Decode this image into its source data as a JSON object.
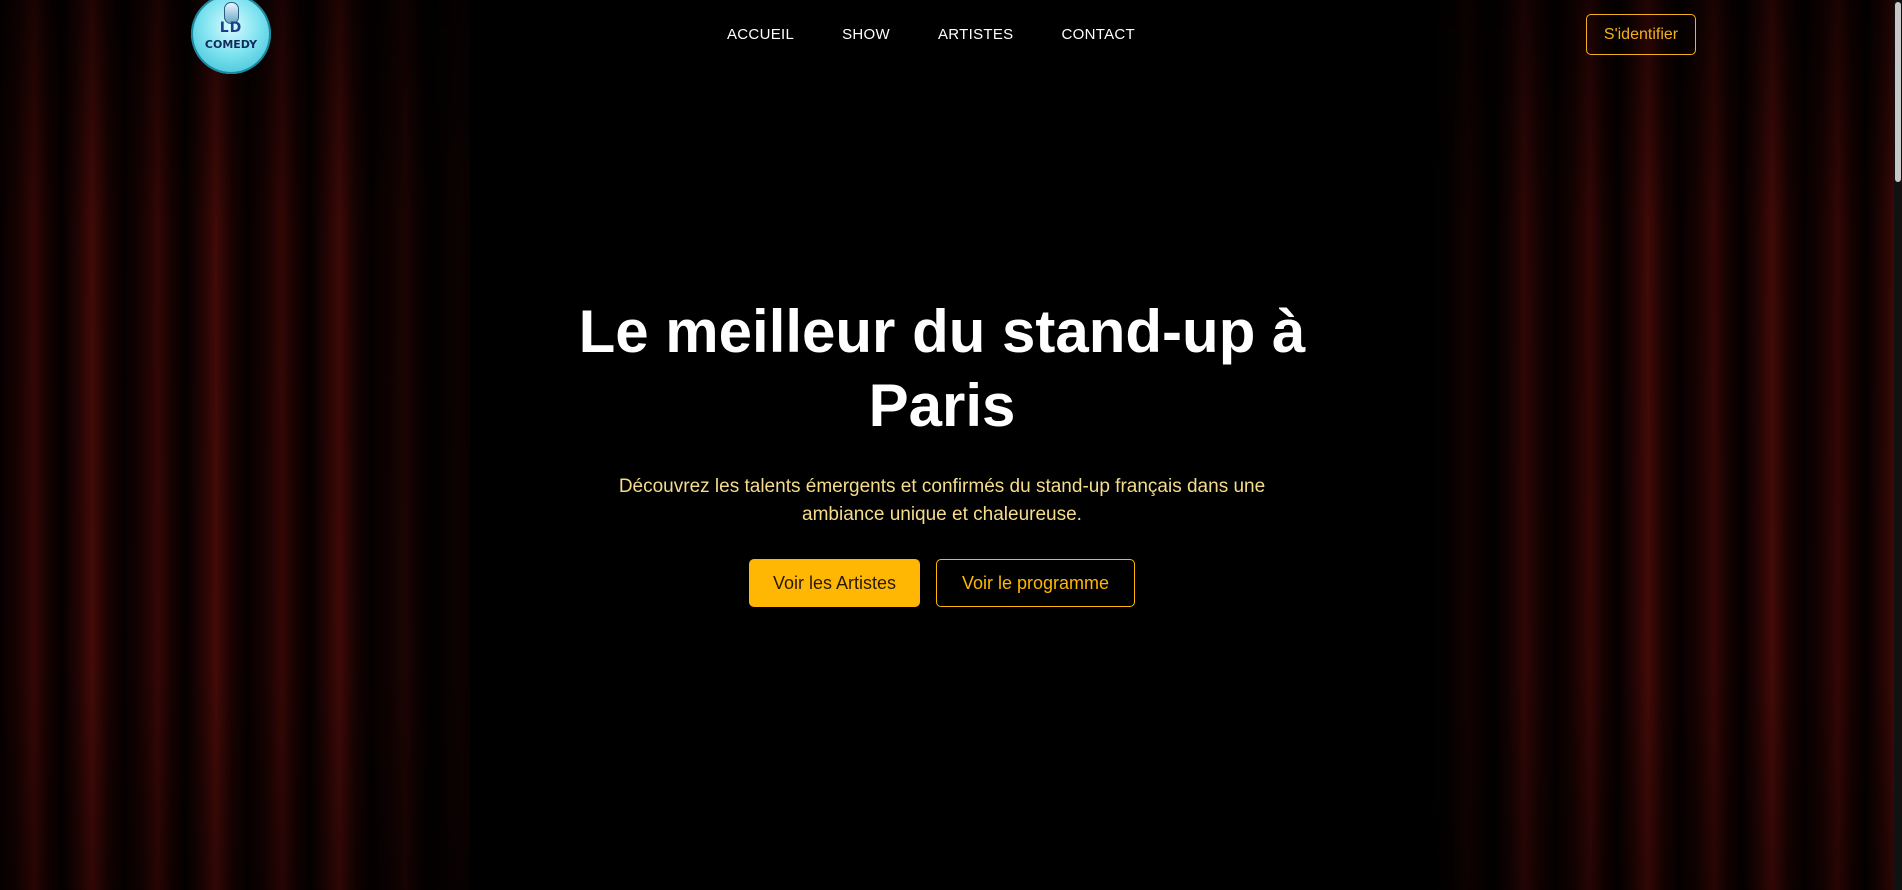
{
  "brand": {
    "logo_text_top": "LD",
    "logo_text_bottom": "COMEDY"
  },
  "nav": {
    "items": [
      {
        "label": "ACCUEIL"
      },
      {
        "label": "SHOW"
      },
      {
        "label": "ARTISTES"
      },
      {
        "label": "CONTACT"
      }
    ]
  },
  "header": {
    "login_label": "S'identifier"
  },
  "hero": {
    "title_line1": "Le meilleur du stand-up à",
    "title_line2": "Paris",
    "subtitle_line1": "Découvrez les talents émergents et confirmés du stand-up français dans une",
    "subtitle_line2": "ambiance unique et chaleureuse.",
    "primary_cta": "Voir les Artistes",
    "secondary_cta": "Voir le programme"
  },
  "colors": {
    "accent": "#ffb703",
    "subtitle": "#f5dc8a",
    "background": "#000000",
    "curtain": "#3a0806"
  }
}
